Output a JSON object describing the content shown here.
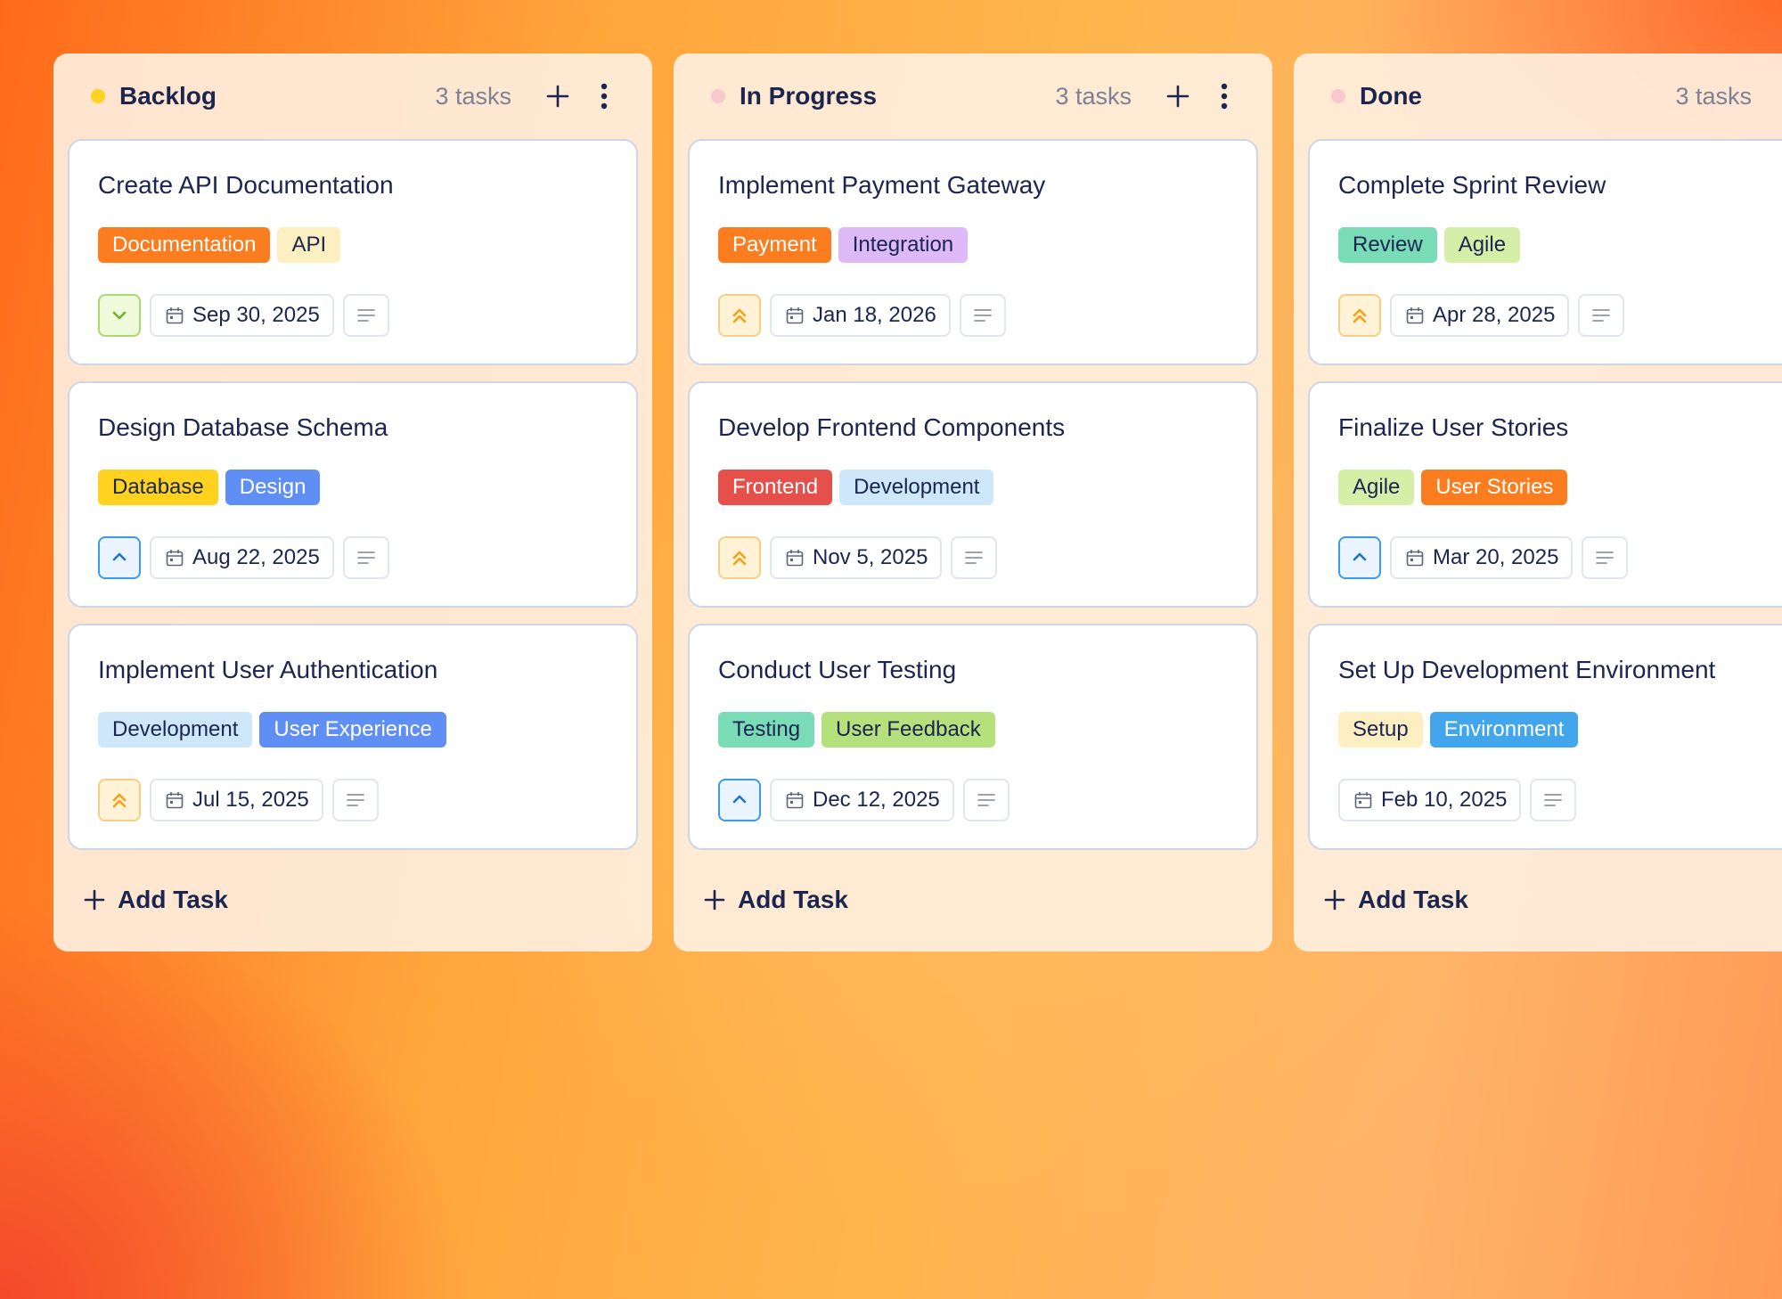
{
  "columns": [
    {
      "title": "Backlog",
      "count": "3 tasks",
      "dot_color": "#ffd21f",
      "add_task": "Add Task",
      "cards": [
        {
          "title": "Create API Documentation",
          "tags": [
            {
              "label": "Documentation",
              "bg": "#fb7d20",
              "fg": "#ffffff"
            },
            {
              "label": "API",
              "bg": "#feefc3",
              "fg": "#1b2550"
            }
          ],
          "priority": "low",
          "priority_icon": "chevron-down-icon",
          "date": "Sep 30, 2025"
        },
        {
          "title": "Design Database Schema",
          "tags": [
            {
              "label": "Database",
              "bg": "#ffd21f",
              "fg": "#1b2550"
            },
            {
              "label": "Design",
              "bg": "#5f8ff4",
              "fg": "#ffffff"
            }
          ],
          "priority": "med",
          "priority_icon": "chevron-up-icon",
          "date": "Aug 22, 2025"
        },
        {
          "title": "Implement User Authentication",
          "tags": [
            {
              "label": "Development",
              "bg": "#cfe7fb",
              "fg": "#1b2550"
            },
            {
              "label": "User Experience",
              "bg": "#5f8ff4",
              "fg": "#ffffff"
            }
          ],
          "priority": "high",
          "priority_icon": "double-chevron-up-icon",
          "date": "Jul 15, 2025"
        }
      ]
    },
    {
      "title": "In Progress",
      "count": "3 tasks",
      "dot_color": "#f8c9cc",
      "add_task": "Add Task",
      "cards": [
        {
          "title": "Implement Payment Gateway",
          "tags": [
            {
              "label": "Payment",
              "bg": "#fb7d20",
              "fg": "#ffffff"
            },
            {
              "label": "Integration",
              "bg": "#ddb9f7",
              "fg": "#1b2550"
            }
          ],
          "priority": "high",
          "priority_icon": "double-chevron-up-icon",
          "date": "Jan 18, 2026"
        },
        {
          "title": "Develop Frontend Components",
          "tags": [
            {
              "label": "Frontend",
              "bg": "#e5504b",
              "fg": "#ffffff"
            },
            {
              "label": "Development",
              "bg": "#cfe7fb",
              "fg": "#1b2550"
            }
          ],
          "priority": "high",
          "priority_icon": "double-chevron-up-icon",
          "date": "Nov 5, 2025"
        },
        {
          "title": "Conduct User Testing",
          "tags": [
            {
              "label": "Testing",
              "bg": "#79dcb7",
              "fg": "#1b2550"
            },
            {
              "label": "User Feedback",
              "bg": "#b6e07b",
              "fg": "#1b2550"
            }
          ],
          "priority": "med",
          "priority_icon": "chevron-up-icon",
          "date": "Dec 12, 2025"
        }
      ]
    },
    {
      "title": "Done",
      "count": "3 tasks",
      "dot_color": "#f8c9cc",
      "add_task": "Add Task",
      "cards": [
        {
          "title": "Complete Sprint Review",
          "tags": [
            {
              "label": "Review",
              "bg": "#79dcb7",
              "fg": "#1b2550"
            },
            {
              "label": "Agile",
              "bg": "#d6efa8",
              "fg": "#1b2550"
            }
          ],
          "priority": "high",
          "priority_icon": "double-chevron-up-icon",
          "date": "Apr 28, 2025"
        },
        {
          "title": "Finalize User Stories",
          "tags": [
            {
              "label": "Agile",
              "bg": "#d6efa8",
              "fg": "#1b2550"
            },
            {
              "label": "User Stories",
              "bg": "#fb7d20",
              "fg": "#ffffff"
            }
          ],
          "priority": "med",
          "priority_icon": "chevron-up-icon",
          "date": "Mar 20, 2025"
        },
        {
          "title": "Set Up Development Environment",
          "tags": [
            {
              "label": "Setup",
              "bg": "#feefc3",
              "fg": "#1b2550"
            },
            {
              "label": "Environment",
              "bg": "#41a6ec",
              "fg": "#ffffff"
            }
          ],
          "priority": "none",
          "priority_icon": "",
          "date": "Feb 10, 2025"
        }
      ]
    }
  ]
}
